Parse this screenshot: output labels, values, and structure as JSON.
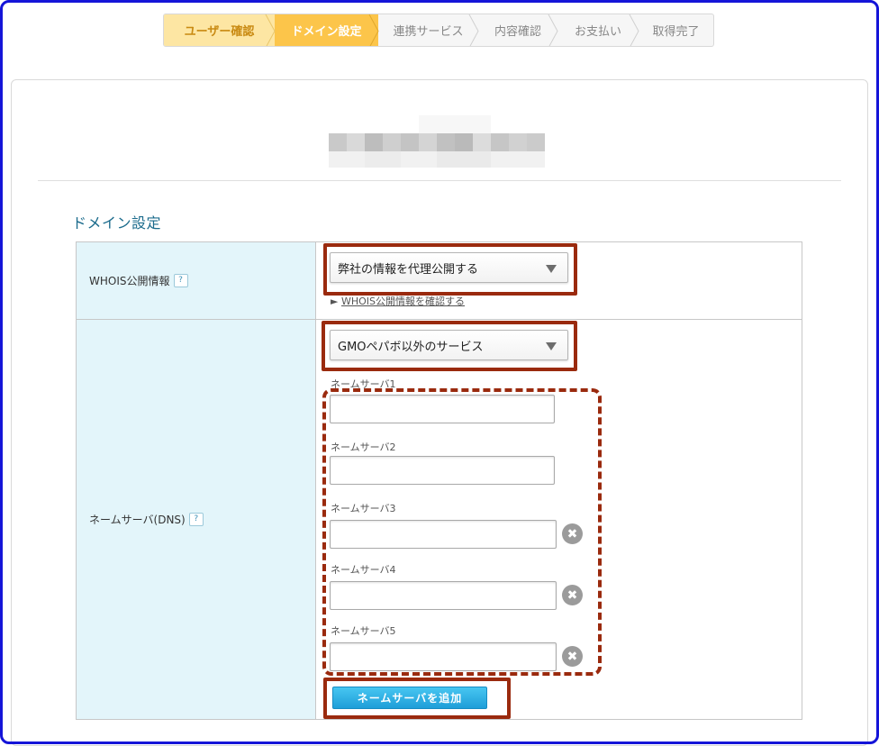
{
  "steps": [
    {
      "label": "ユーザー確認",
      "state": "done"
    },
    {
      "label": "ドメイン設定",
      "state": "active"
    },
    {
      "label": "連携サービス",
      "state": "pending"
    },
    {
      "label": "内容確認",
      "state": "pending"
    },
    {
      "label": "お支払い",
      "state": "pending"
    },
    {
      "label": "取得完了",
      "state": "pending"
    }
  ],
  "section_title": "ドメイン設定",
  "whois": {
    "label": "WHOIS公開情報",
    "help": "?",
    "select_value": "弊社の情報を代理公開する",
    "link_text": "WHOIS公開情報を確認する"
  },
  "nameserver": {
    "label": "ネームサーバ(DNS)",
    "help": "?",
    "select_value": "GMOペパボ以外のサービス",
    "fields": [
      {
        "label": "ネームサーバ1",
        "value": ""
      },
      {
        "label": "ネームサーバ2",
        "value": ""
      },
      {
        "label": "ネームサーバ3",
        "value": ""
      },
      {
        "label": "ネームサーバ4",
        "value": ""
      },
      {
        "label": "ネームサーバ5",
        "value": ""
      }
    ],
    "delete_symbol": "✖",
    "add_button": "ネームサーバを追加"
  },
  "colors": {
    "accent": "#fcc54a",
    "highlight": "#9a2a0e",
    "label_bg": "#e3f5fa",
    "button": "#1e9ed8",
    "window_border": "#1414d8"
  }
}
